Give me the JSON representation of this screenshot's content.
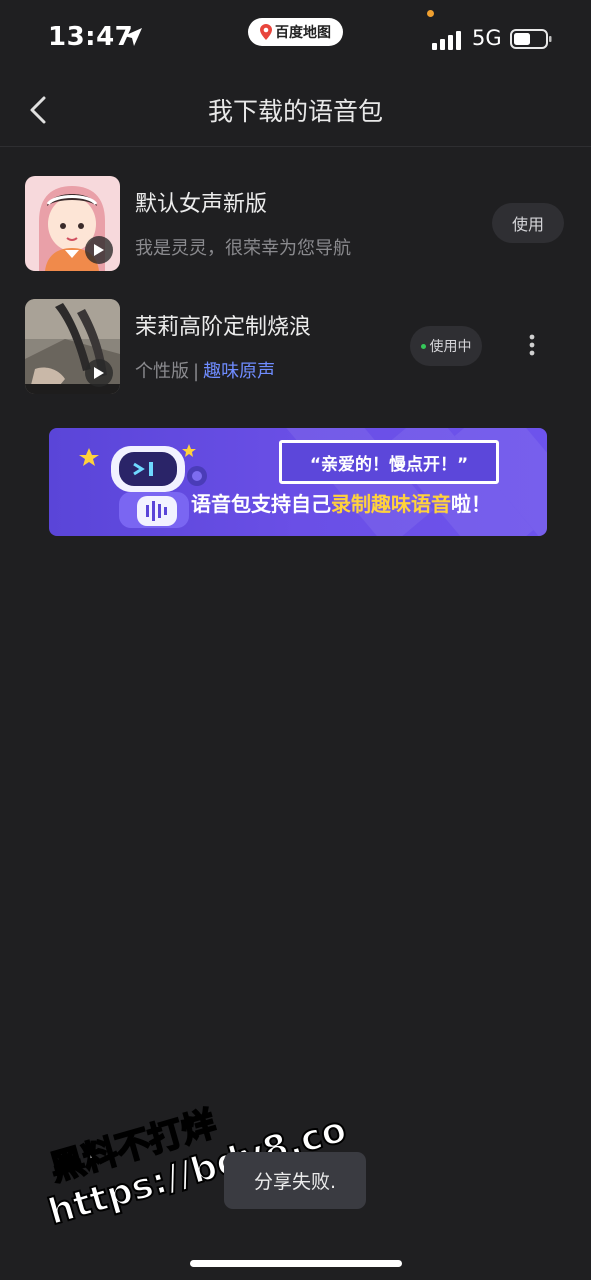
{
  "status_bar": {
    "time": "13:47",
    "map_app_label": "百度地图",
    "network": "5G",
    "icons": [
      "location-arrow-icon",
      "map-pin-icon",
      "signal-icon",
      "battery-icon"
    ]
  },
  "header": {
    "title": "我下载的语音包",
    "back_icon": "chevron-left-icon"
  },
  "voice_packs": [
    {
      "name": "默认女声新版",
      "description": "我是灵灵，很荣幸为您导航",
      "action_label": "使用",
      "status": "available"
    },
    {
      "name": "茉莉高阶定制烧浪",
      "description_plain": "个性版",
      "separator": "|",
      "description_link": "趣味原声",
      "action_label": "使用中",
      "status": "in-use",
      "more_icon": "more-vertical-icon"
    }
  ],
  "banner": {
    "quote": "“亲爱的！慢点开！”",
    "tagline_pre": "语音包支持自己",
    "tagline_highlight": "录制趣味语音",
    "tagline_post": "啦！"
  },
  "toast": {
    "message": "分享失败."
  },
  "watermark": {
    "line1": "黑料不打烊",
    "line2": "https://bdy8.co"
  },
  "colors": {
    "background": "#1f1f21",
    "link": "#6f8cff",
    "banner": "#6a4fe6",
    "highlight": "#ffd23c",
    "in_use_dot": "#35c759"
  }
}
